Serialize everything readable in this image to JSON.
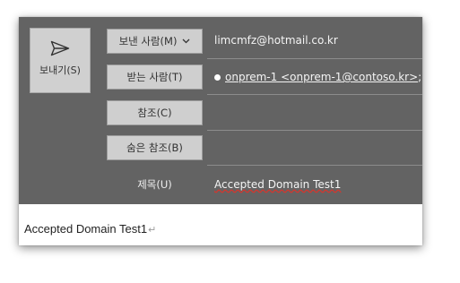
{
  "send": {
    "label": "보내기(S)",
    "icon": "paper-plane-icon"
  },
  "fields": {
    "from_button": "보낸 사람(M)",
    "from_value": "limcmfz@hotmail.co.kr",
    "to_button": "받는 사람(T)",
    "to_recipient": "onprem-1 <onprem-1@contoso.kr>",
    "to_separator": ";",
    "cc_button": "참조(C)",
    "bcc_button": "숨은 참조(B)",
    "subject_label": "제목(U)",
    "subject_value": "Accepted Domain Test1"
  },
  "body": {
    "text": "Accepted Domain Test1",
    "paragraph_mark": "↵"
  },
  "colors": {
    "header_bg": "#636363",
    "button_bg": "#cfcfcf",
    "spellcheck_underline": "#d9342b"
  }
}
